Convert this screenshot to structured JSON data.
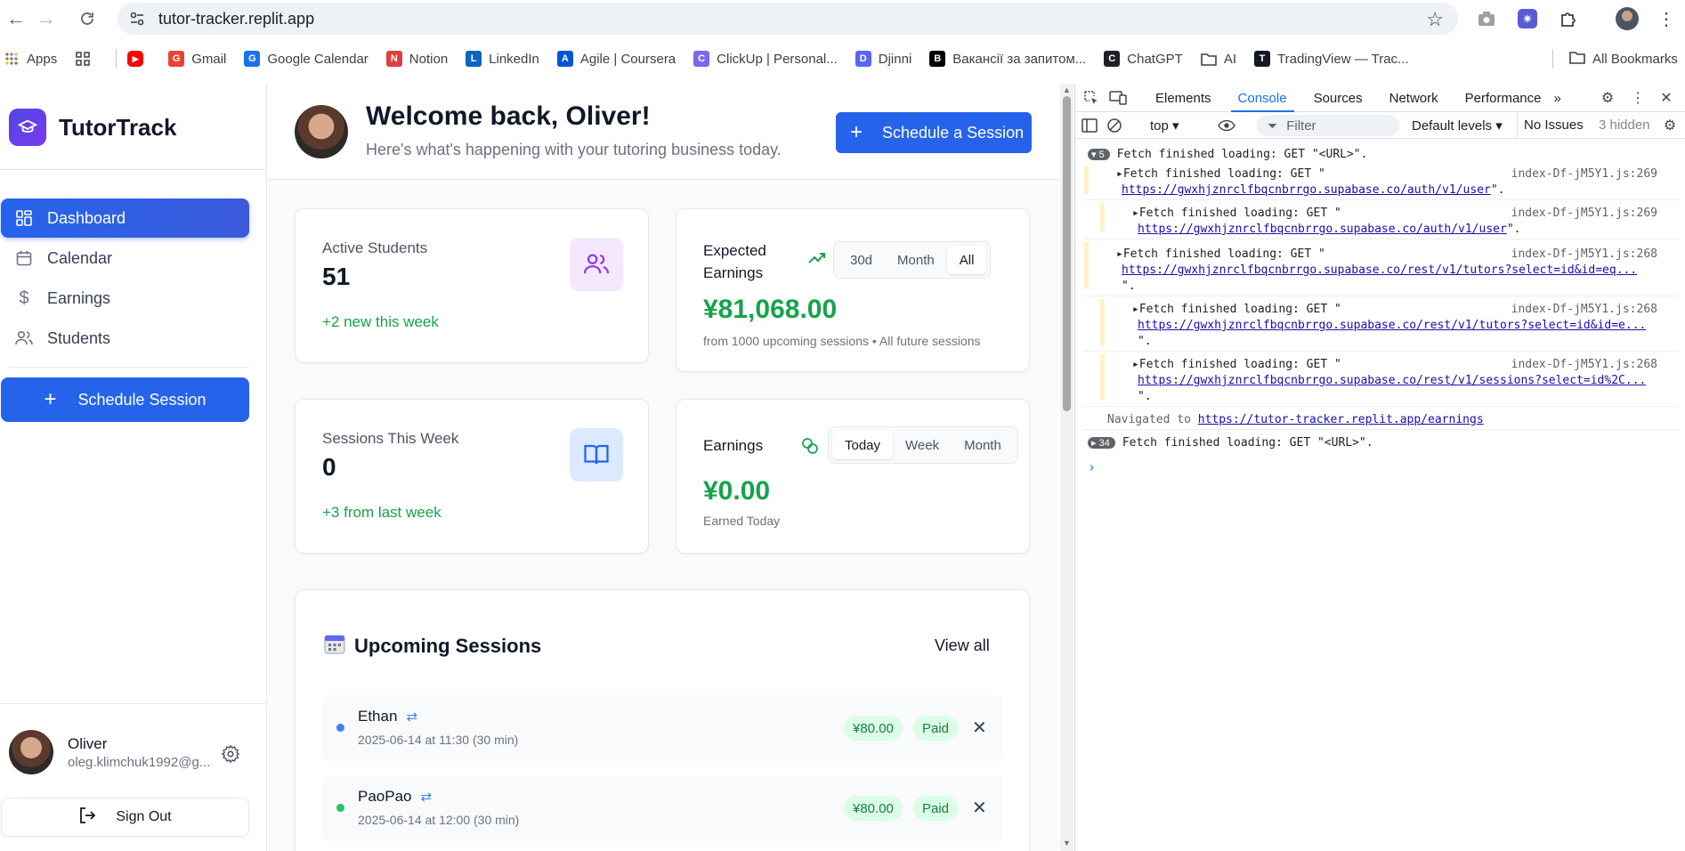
{
  "browser": {
    "url": "tutor-tracker.replit.app",
    "bookmarks": [
      {
        "label": "Apps",
        "icon": "apps-grid-icon",
        "color": "#ea4335"
      },
      {
        "label": "",
        "icon": "grid-icon",
        "color": "#5f6368"
      },
      {
        "label": "",
        "icon": "youtube-icon",
        "color": "#ff0000"
      },
      {
        "label": "Gmail",
        "icon": "gmail-icon",
        "color": "#ea4335"
      },
      {
        "label": "Google Calendar",
        "icon": "google-calendar-icon",
        "color": "#1a73e8"
      },
      {
        "label": "Notion",
        "icon": "notion-icon",
        "color": "#e03e3e"
      },
      {
        "label": "LinkedIn",
        "icon": "linkedin-icon",
        "color": "#0a66c2"
      },
      {
        "label": "Agile | Coursera",
        "icon": "coursera-icon",
        "color": "#0056d2"
      },
      {
        "label": "ClickUp | Personal...",
        "icon": "clickup-icon",
        "color": "#7b68ee"
      },
      {
        "label": "Djinni",
        "icon": "djinni-icon",
        "color": "#5865f2"
      },
      {
        "label": "Вакансії за запитом...",
        "icon": "dou-icon",
        "color": "#000000"
      },
      {
        "label": "ChatGPT",
        "icon": "chatgpt-icon",
        "color": "#202124"
      },
      {
        "label": "AI",
        "icon": "folder-icon",
        "color": "#5f6368"
      },
      {
        "label": "TradingView — Trac...",
        "icon": "tradingview-icon",
        "color": "#131722"
      }
    ],
    "all_bookmarks": "All Bookmarks"
  },
  "sidebar": {
    "brand": "TutorTrack",
    "nav": [
      {
        "label": "Dashboard",
        "icon": "dashboard-icon",
        "active": true
      },
      {
        "label": "Calendar",
        "icon": "calendar-icon",
        "active": false
      },
      {
        "label": "Earnings",
        "icon": "dollar-icon",
        "active": false
      },
      {
        "label": "Students",
        "icon": "users-icon",
        "active": false
      }
    ],
    "schedule_button": "Schedule Session",
    "user": {
      "name": "Oliver",
      "email": "oleg.klimchuk1992@g..."
    },
    "sign_out": "Sign Out"
  },
  "header": {
    "welcome": "Welcome back, Oliver!",
    "subtitle": "Here's what's happening with your tutoring business today.",
    "schedule_button": "Schedule a Session"
  },
  "stats": {
    "active_students": {
      "label": "Active Students",
      "value": "51",
      "trend": "+2 new this week"
    },
    "expected_earnings": {
      "label": "Expected Earnings",
      "options": [
        "30d",
        "Month",
        "All"
      ],
      "selected": "All",
      "value": "¥81,068.00",
      "sub": "from 1000 upcoming sessions • All future sessions"
    },
    "sessions_week": {
      "label": "Sessions This Week",
      "value": "0",
      "trend": "+3 from last week"
    },
    "earnings": {
      "label": "Earnings",
      "options": [
        "Today",
        "Week",
        "Month"
      ],
      "selected": "Today",
      "value": "¥0.00",
      "sub": "Earned Today"
    }
  },
  "upcoming": {
    "title": "Upcoming Sessions",
    "view_all": "View all",
    "sessions": [
      {
        "name": "Ethan",
        "time": "2025-06-14 at 11:30 (30 min)",
        "price": "¥80.00",
        "status": "Paid",
        "dot": "#3b82f6"
      },
      {
        "name": "PaoPao",
        "time": "2025-06-14 at 12:00 (30 min)",
        "price": "¥80.00",
        "status": "Paid",
        "dot": "#22c55e"
      }
    ]
  },
  "devtools": {
    "tabs": [
      "Elements",
      "Console",
      "Sources",
      "Network",
      "Performance"
    ],
    "active_tab": "Console",
    "context": "top",
    "filter_placeholder": "Filter",
    "levels": "Default levels",
    "issues": "No Issues",
    "hidden": "3 hidden",
    "logs": {
      "l1": {
        "count": "5",
        "text": "Fetch finished loading: GET \"<URL>\"."
      },
      "l2": {
        "text": "Fetch finished loading: GET \"",
        "src": "index-Df-jM5Y1.js:269",
        "link": "https://gwxhjznrclfbqcnbrrgo.supabase.co/auth/v1/user",
        "end": "\"."
      },
      "l3": {
        "text": "Fetch finished loading: GET \"",
        "src": "index-Df-jM5Y1.js:269",
        "link": "https://gwxhjznrclfbqcnbrrgo.supabase.co/auth/v1/user",
        "end": "\"."
      },
      "l4": {
        "text": "Fetch finished loading: GET \"",
        "src": "index-Df-jM5Y1.js:268",
        "link": "https://gwxhjznrclfbqcnbrrgo.supabase.co/rest/v1/tutors?select=id&id=eq...",
        "end": "\"."
      },
      "l5": {
        "text": "Fetch finished loading: GET \"",
        "src": "index-Df-jM5Y1.js:268",
        "link": "https://gwxhjznrclfbqcnbrrgo.supabase.co/rest/v1/tutors?select=id&id=e...",
        "end": "\"."
      },
      "l6": {
        "text": "Fetch finished loading: GET \"",
        "src": "index-Df-jM5Y1.js:268",
        "link": "https://gwxhjznrclfbqcnbrrgo.supabase.co/rest/v1/sessions?select=id%2C...",
        "end": "\"."
      },
      "nav": {
        "text": "Navigated to ",
        "link": "https://tutor-tracker.replit.app/earnings"
      },
      "l7": {
        "count": "34",
        "text": "Fetch finished loading: GET \"<URL>\"."
      }
    }
  }
}
